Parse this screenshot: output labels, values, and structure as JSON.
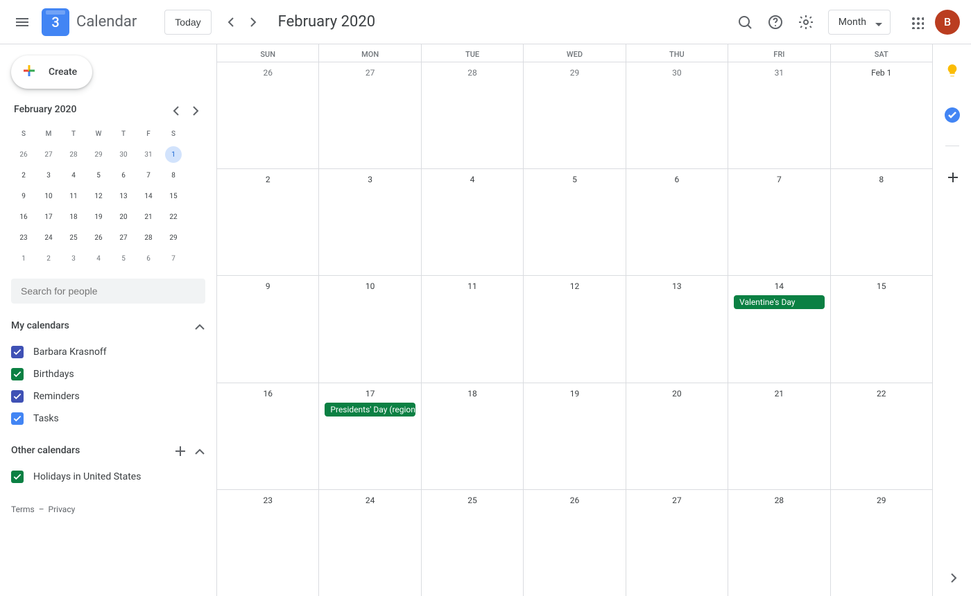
{
  "header": {
    "app_name": "Calendar",
    "logo_day": "3",
    "today_label": "Today",
    "period_title": "February 2020",
    "view_label": "Month",
    "avatar_initial": "B"
  },
  "sidebar": {
    "create_label": "Create",
    "minical_title": "February 2020",
    "day_initials": [
      "S",
      "M",
      "T",
      "W",
      "T",
      "F",
      "S"
    ],
    "minical_rows": [
      [
        {
          "n": "26"
        },
        {
          "n": "27"
        },
        {
          "n": "28"
        },
        {
          "n": "29"
        },
        {
          "n": "30"
        },
        {
          "n": "31"
        },
        {
          "n": "1",
          "in": true,
          "sel": true
        }
      ],
      [
        {
          "n": "2",
          "in": true
        },
        {
          "n": "3",
          "in": true
        },
        {
          "n": "4",
          "in": true
        },
        {
          "n": "5",
          "in": true
        },
        {
          "n": "6",
          "in": true
        },
        {
          "n": "7",
          "in": true
        },
        {
          "n": "8",
          "in": true
        }
      ],
      [
        {
          "n": "9",
          "in": true
        },
        {
          "n": "10",
          "in": true
        },
        {
          "n": "11",
          "in": true
        },
        {
          "n": "12",
          "in": true
        },
        {
          "n": "13",
          "in": true
        },
        {
          "n": "14",
          "in": true
        },
        {
          "n": "15",
          "in": true
        }
      ],
      [
        {
          "n": "16",
          "in": true
        },
        {
          "n": "17",
          "in": true
        },
        {
          "n": "18",
          "in": true
        },
        {
          "n": "19",
          "in": true
        },
        {
          "n": "20",
          "in": true
        },
        {
          "n": "21",
          "in": true
        },
        {
          "n": "22",
          "in": true
        }
      ],
      [
        {
          "n": "23",
          "in": true
        },
        {
          "n": "24",
          "in": true
        },
        {
          "n": "25",
          "in": true
        },
        {
          "n": "26",
          "in": true
        },
        {
          "n": "27",
          "in": true
        },
        {
          "n": "28",
          "in": true
        },
        {
          "n": "29",
          "in": true
        }
      ],
      [
        {
          "n": "1"
        },
        {
          "n": "2"
        },
        {
          "n": "3"
        },
        {
          "n": "4"
        },
        {
          "n": "5"
        },
        {
          "n": "6"
        },
        {
          "n": "7"
        }
      ]
    ],
    "search_placeholder": "Search for people",
    "my_calendars_label": "My calendars",
    "my_calendars": [
      {
        "name": "Barbara Krasnoff",
        "color": "#3f51b5"
      },
      {
        "name": "Birthdays",
        "color": "#0b8043"
      },
      {
        "name": "Reminders",
        "color": "#3f51b5"
      },
      {
        "name": "Tasks",
        "color": "#4285f4"
      }
    ],
    "other_calendars_label": "Other calendars",
    "other_calendars": [
      {
        "name": "Holidays in United States",
        "color": "#0b8043"
      }
    ],
    "terms_label": "Terms",
    "privacy_label": "Privacy"
  },
  "grid": {
    "day_headers": [
      "SUN",
      "MON",
      "TUE",
      "WED",
      "THU",
      "FRI",
      "SAT"
    ],
    "weeks": [
      [
        {
          "n": "26"
        },
        {
          "n": "27"
        },
        {
          "n": "28"
        },
        {
          "n": "29"
        },
        {
          "n": "30"
        },
        {
          "n": "31"
        },
        {
          "n": "Feb 1",
          "in": true,
          "first": true
        }
      ],
      [
        {
          "n": "2",
          "in": true
        },
        {
          "n": "3",
          "in": true
        },
        {
          "n": "4",
          "in": true
        },
        {
          "n": "5",
          "in": true
        },
        {
          "n": "6",
          "in": true
        },
        {
          "n": "7",
          "in": true
        },
        {
          "n": "8",
          "in": true
        }
      ],
      [
        {
          "n": "9",
          "in": true
        },
        {
          "n": "10",
          "in": true
        },
        {
          "n": "11",
          "in": true
        },
        {
          "n": "12",
          "in": true
        },
        {
          "n": "13",
          "in": true
        },
        {
          "n": "14",
          "in": true,
          "events": [
            {
              "title": "Valentine's Day"
            }
          ]
        },
        {
          "n": "15",
          "in": true
        }
      ],
      [
        {
          "n": "16",
          "in": true
        },
        {
          "n": "17",
          "in": true,
          "events": [
            {
              "title": "Presidents' Day (regional holiday)"
            }
          ]
        },
        {
          "n": "18",
          "in": true
        },
        {
          "n": "19",
          "in": true
        },
        {
          "n": "20",
          "in": true
        },
        {
          "n": "21",
          "in": true
        },
        {
          "n": "22",
          "in": true
        }
      ],
      [
        {
          "n": "23",
          "in": true
        },
        {
          "n": "24",
          "in": true
        },
        {
          "n": "25",
          "in": true
        },
        {
          "n": "26",
          "in": true
        },
        {
          "n": "27",
          "in": true
        },
        {
          "n": "28",
          "in": true
        },
        {
          "n": "29",
          "in": true
        }
      ]
    ]
  },
  "colors": {
    "event_green": "#0b8043"
  }
}
